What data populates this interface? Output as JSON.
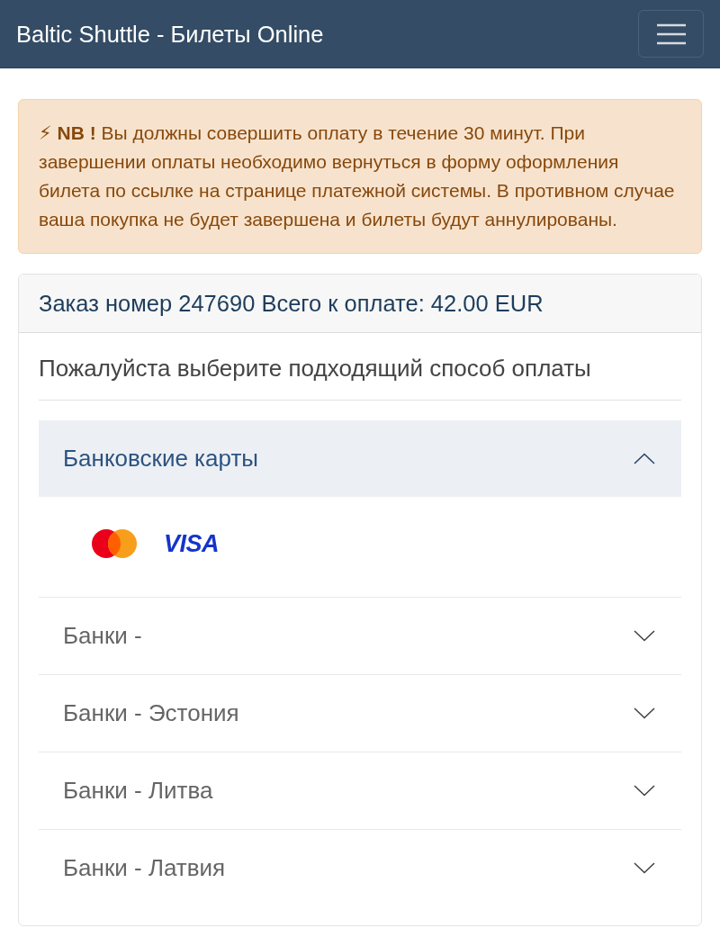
{
  "navbar": {
    "brand": "Baltic Shuttle - Билеты Online"
  },
  "alert": {
    "text": "**⚡ NB !** Вы должны совершить оплату в течение 30 минут. При завершении оплаты необходимо вернуться в форму оформления билета по ссылке на странице платежной системы. В противном случае ваша покупка не будет завершена и билеты будут аннулированы."
  },
  "order": {
    "header": "Заказ номер 247690 Всего к оплате: 42.00 EUR",
    "prompt": "Пожалуйста выберите подходящий способ оплаты",
    "payment_groups": [
      {
        "title": "Банковские карты",
        "expanded": true,
        "methods": [
          {
            "kind": "mastercard"
          },
          {
            "kind": "visa",
            "label": "VISA"
          }
        ]
      },
      {
        "title": "Банки -",
        "expanded": false
      },
      {
        "title": "Банки - Эстония",
        "expanded": false
      },
      {
        "title": "Банки - Литва",
        "expanded": false
      },
      {
        "title": "Банки - Латвия",
        "expanded": false
      }
    ]
  }
}
